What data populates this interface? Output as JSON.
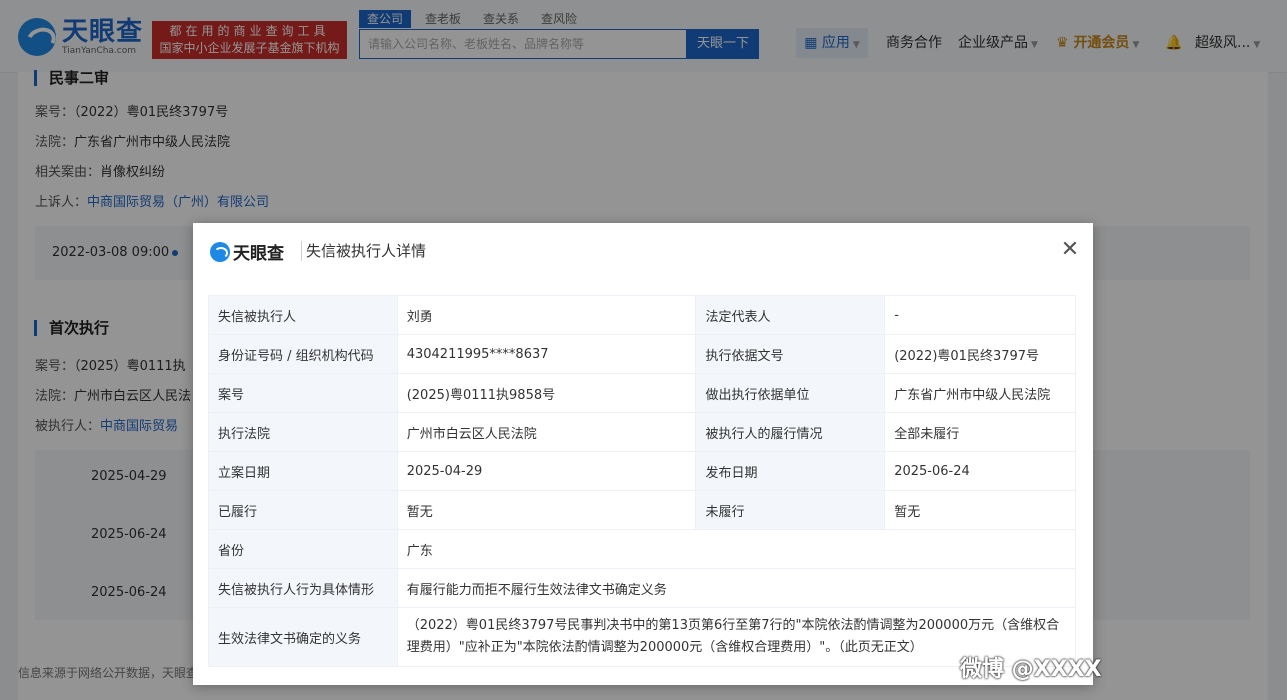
{
  "header": {
    "logo_cn": "天眼查",
    "logo_en": "TianYanCha.com",
    "promo_line1": "都在用的商业查询工具",
    "promo_line2": "国家中小企业发展子基金旗下机构",
    "search_tabs": [
      "查公司",
      "查老板",
      "查关系",
      "查风险"
    ],
    "search_placeholder": "请输入公司名称、老板姓名、品牌名称等",
    "search_button": "天眼一下",
    "nav": {
      "app": "应用",
      "business": "商务合作",
      "enterprise": "企业级产品",
      "vip": "开通会员",
      "user": "超级风..."
    }
  },
  "background": {
    "section1_title": "民事二审",
    "case_no_label": "案号：",
    "case_no": "（2022）粤01民终3797号",
    "court_label": "法院：",
    "court": "广东省广州市中级人民法院",
    "cause_label": "相关案由：",
    "cause": "肖像权纠纷",
    "appellant_label": "上诉人：",
    "appellant": "中商国际贸易（广州）有限公司",
    "date1": "2022-03-08 09:00",
    "section2_title": "首次执行",
    "case2_label": "案号：",
    "case2": "（2025）粤0111执",
    "court2_label": "法院：",
    "court2": "广州市白云区人民法",
    "executed_label": "被执行人：",
    "executed": "中商国际贸易",
    "tl_dates": [
      "2025-04-29",
      "2025-06-24",
      "2025-06-24"
    ],
    "footer": "信息来源于网络公开数据，天眼查"
  },
  "modal": {
    "logo": "天眼查",
    "title": "失信被执行人详情",
    "rows": [
      {
        "l1": "失信被执行人",
        "v1": "刘勇",
        "l2": "法定代表人",
        "v2": "-"
      },
      {
        "l1": "身份证号码 / 组织机构代码",
        "v1": "4304211995****8637",
        "l2": "执行依据文号",
        "v2": "(2022)粤01民终3797号"
      },
      {
        "l1": "案号",
        "v1": "(2025)粤0111执9858号",
        "l2": "做出执行依据单位",
        "v2": "广东省广州市中级人民法院"
      },
      {
        "l1": "执行法院",
        "v1": "广州市白云区人民法院",
        "l2": "被执行人的履行情况",
        "v2": "全部未履行"
      },
      {
        "l1": "立案日期",
        "v1": "2025-04-29",
        "l2": "发布日期",
        "v2": "2025-06-24"
      },
      {
        "l1": "已履行",
        "v1": "暂无",
        "l2": "未履行",
        "v2": "暂无"
      }
    ],
    "province_label": "省份",
    "province": "广东",
    "behavior_label": "失信被执行人行为具体情形",
    "behavior": "有履行能力而拒不履行生效法律文书确定义务",
    "obligation_label": "生效法律文书确定的义务",
    "obligation": "（2022）粤01民终3797号民事判决书中的第13页第6行至第7行的\"本院依法酌情调整为200000万元（含维权合理费用）\"应补正为\"本院依法酌情调整为200000元（含维权合理费用）\"。（此页无正文）"
  },
  "watermark": "微博 @XXXX"
}
